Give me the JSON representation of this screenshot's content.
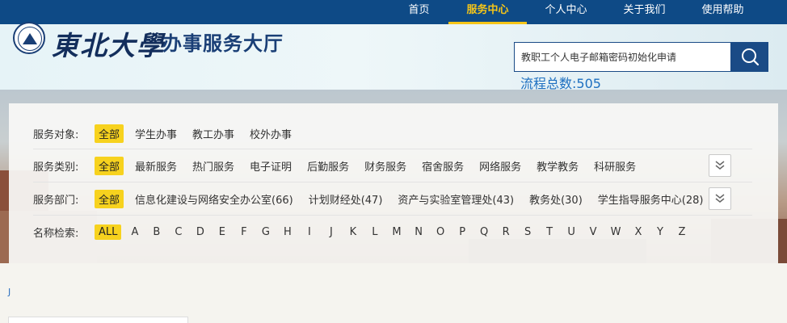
{
  "nav": {
    "items": [
      {
        "label": "首页"
      },
      {
        "label": "服务中心"
      },
      {
        "label": "个人中心"
      },
      {
        "label": "关于我们"
      },
      {
        "label": "使用帮助"
      }
    ]
  },
  "header": {
    "logo_text": "東北大學",
    "site_title": "办事服务大厅"
  },
  "search": {
    "value": "教职工个人电子邮箱密码初始化申请",
    "icon": "search-icon"
  },
  "stats": {
    "process_count": "流程总数:505"
  },
  "filters": {
    "audience": {
      "label": "服务对象:",
      "options": [
        "全部",
        "学生办事",
        "教工办事",
        "校外办事"
      ]
    },
    "category": {
      "label": "服务类别:",
      "options": [
        "全部",
        "最新服务",
        "热门服务",
        "电子证明",
        "后勤服务",
        "财务服务",
        "宿舍服务",
        "网络服务",
        "教学教务",
        "科研服务"
      ]
    },
    "department": {
      "label": "服务部门:",
      "options": [
        "全部",
        "信息化建设与网络安全办公室(66)",
        "计划财经处(47)",
        "资产与实验室管理处(43)",
        "教务处(30)",
        "学生指导服务中心(28)"
      ]
    },
    "name_index": {
      "label": "名称检索:",
      "options": [
        "ALL",
        "A",
        "B",
        "C",
        "D",
        "E",
        "F",
        "G",
        "H",
        "I",
        "J",
        "K",
        "L",
        "M",
        "N",
        "O",
        "P",
        "Q",
        "R",
        "S",
        "T",
        "U",
        "V",
        "W",
        "X",
        "Y",
        "Z"
      ]
    }
  },
  "misc": {
    "link_fragment": "J"
  },
  "colors": {
    "topbar": "#0e4a86",
    "accent": "#f5c518",
    "selected_bg": "#f7d21e",
    "title_blue": "#1a3f76",
    "count_blue": "#1d6fc0"
  }
}
